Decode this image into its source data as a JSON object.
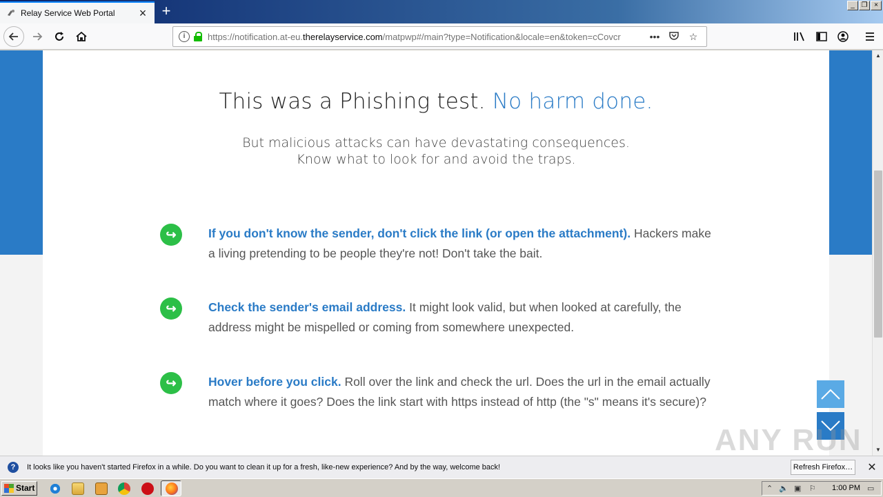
{
  "browser": {
    "tab_title": "Relay Service Web Portal",
    "url_prefix": "https://notification.at-eu.",
    "url_domain": "therelayservice.com",
    "url_rest": "/matpwp#/main?type=Notification&locale=en&token=cCovcr",
    "icons": [
      "back-icon",
      "forward-icon",
      "reload-icon",
      "home-icon",
      "info-icon",
      "lock-icon",
      "page-actions-icon",
      "pocket-icon",
      "bookmark-star-icon",
      "library-icon",
      "sidebar-icon",
      "account-icon",
      "menu-icon"
    ]
  },
  "page": {
    "headline_main": "This was a Phishing test.",
    "headline_accent": "No harm done.",
    "sub_line1": "But malicious attacks can have devastating consequences.",
    "sub_line2": "Know what to look for and avoid the traps.",
    "tips": [
      {
        "head": "If you don't know the sender, don't click the link (or open the attachment).",
        "body": " Hackers make a living pretending to be people they're not! Don't take the bait."
      },
      {
        "head": "Check the sender's email address.",
        "body": " It might look valid, but when looked at carefully, the address might be mispelled or coming from somewhere unexpected."
      },
      {
        "head": "Hover before you click.",
        "body": " Roll over the link and check the url. Does the url in the email actually match where it goes? Does the link start with https instead of http (the \"s\" means it's secure)?"
      }
    ],
    "colors": {
      "accent": "#2a7bc6",
      "tip_icon": "#2cbf47",
      "band": "#2a7bc6"
    },
    "watermark": "ANY RUN"
  },
  "notification": {
    "message": "It looks like you haven't started Firefox in a while. Do you want to clean it up for a fresh, like-new experience? And by the way, welcome back!",
    "button": "Refresh Firefox…"
  },
  "taskbar": {
    "start": "Start",
    "clock": "1:00 PM"
  }
}
